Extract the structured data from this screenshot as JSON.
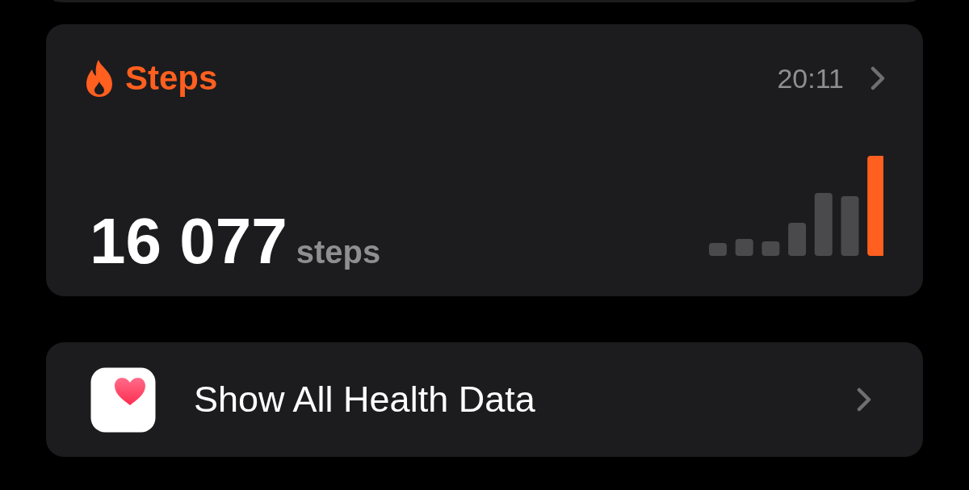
{
  "steps_card": {
    "title": "Steps",
    "time": "20:11",
    "value": "16 077",
    "unit": "steps"
  },
  "health_link": {
    "label": "Show All Health Data"
  }
}
